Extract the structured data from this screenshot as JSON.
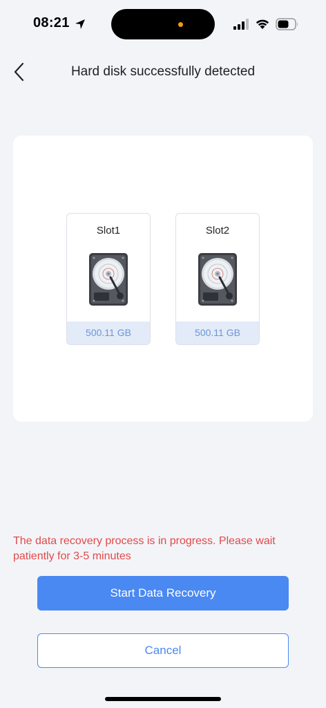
{
  "status_bar": {
    "time": "08:21",
    "icons": [
      "location-arrow-icon",
      "cellular-signal-icon",
      "wifi-icon",
      "battery-icon"
    ],
    "indicator_color": "#f29a1a"
  },
  "header": {
    "back_icon": "chevron-left-icon",
    "title": "Hard disk successfully detected"
  },
  "slots": [
    {
      "name": "Slot1",
      "size": "500.11 GB",
      "icon": "hard-disk-icon"
    },
    {
      "name": "Slot2",
      "size": "500.11 GB",
      "icon": "hard-disk-icon"
    }
  ],
  "status_message": "The data recovery process is in progress. Please wait patiently for 3-5 minutes",
  "buttons": {
    "start_label": "Start Data Recovery",
    "cancel_label": "Cancel"
  },
  "colors": {
    "accent": "#4a88f2",
    "warning_text": "#e04a4a",
    "size_text": "#6d95d4",
    "size_background": "#e3ebf9",
    "page_background": "#f3f4f8"
  }
}
